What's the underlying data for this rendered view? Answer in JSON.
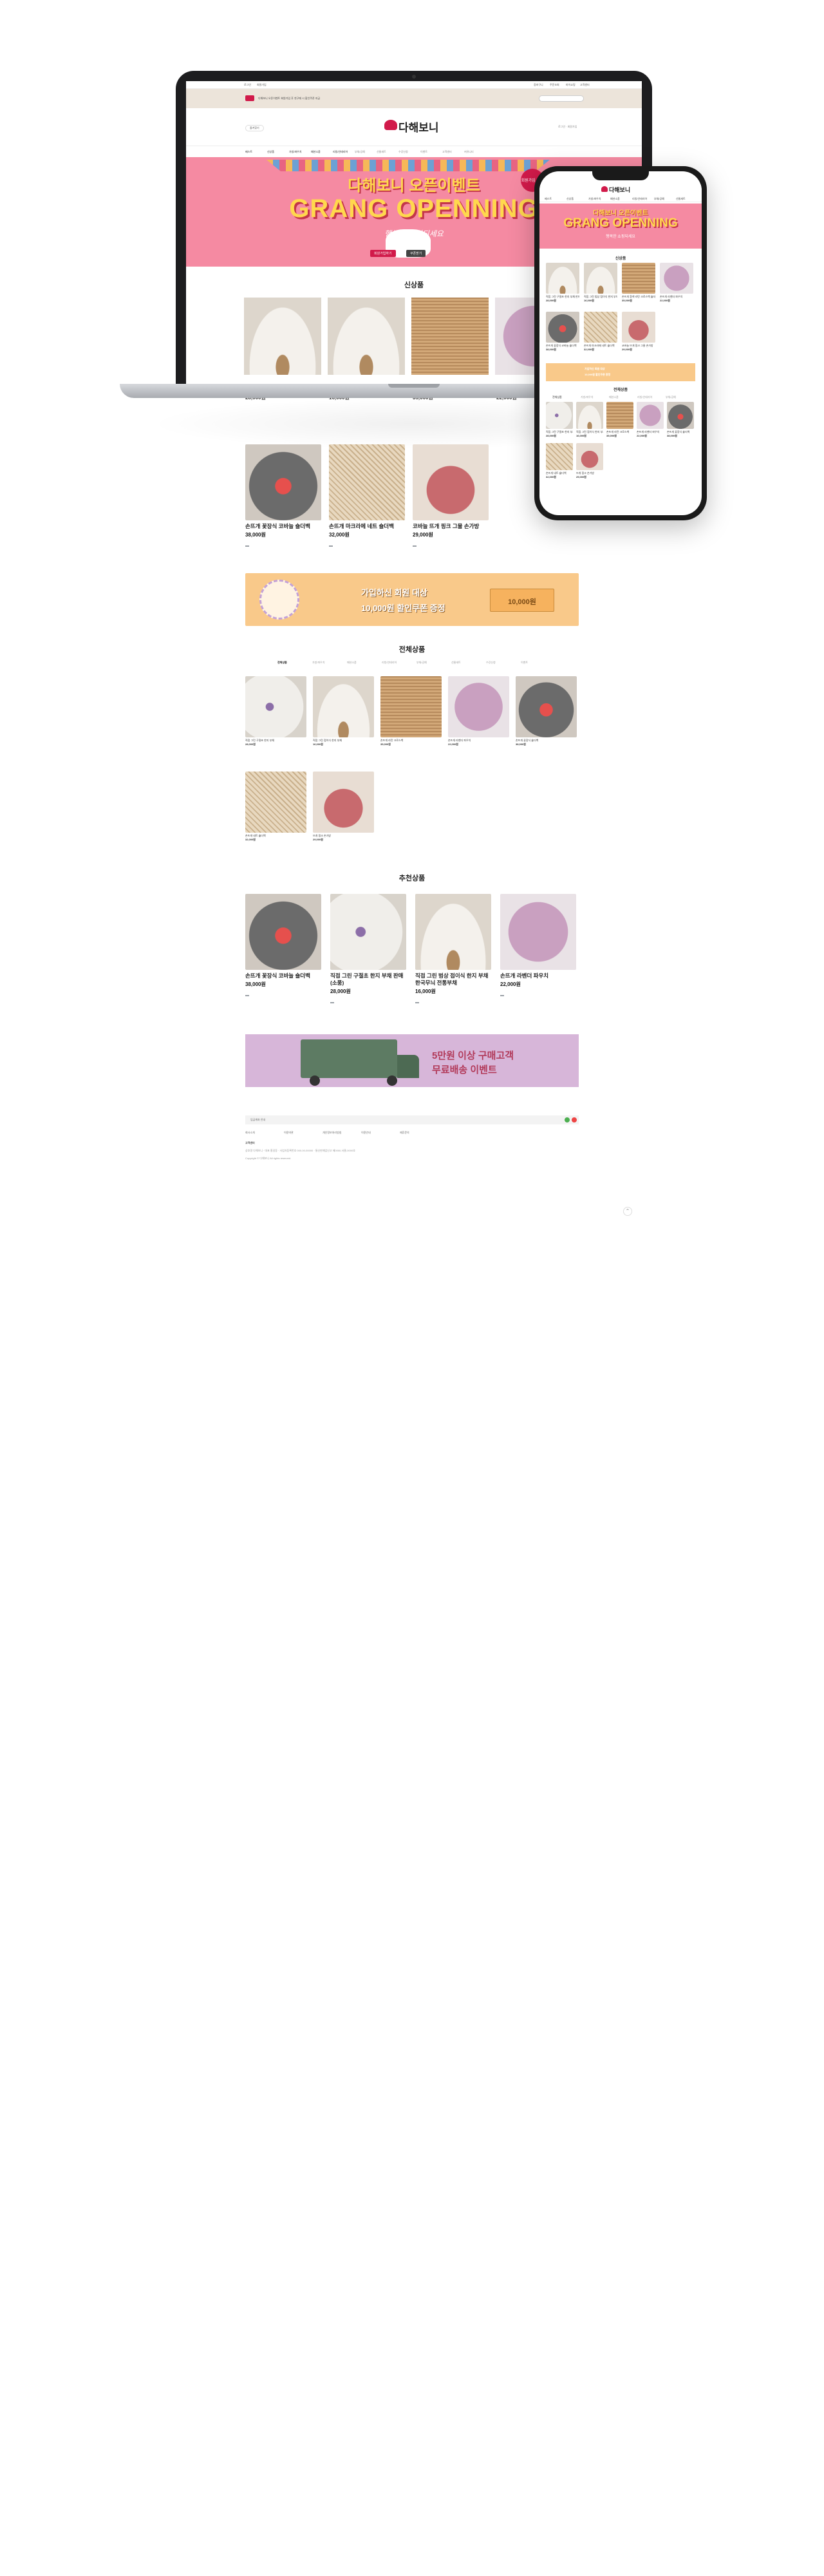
{
  "brand": {
    "logo_text": "다해보니",
    "accent": "#d11a4a",
    "banner_pink": "#f58aa2",
    "tan_bar": "#ece4da"
  },
  "top_bar": {
    "left_links": [
      "로그인",
      "회원가입"
    ],
    "right_links": [
      "장바구니",
      "주문조회",
      "마이쇼핑",
      "고객센터"
    ]
  },
  "notice_bar": {
    "text": "다해보니 오픈이벤트 회원가입 후 첫구매 시 할인쿠폰 지급"
  },
  "header": {
    "search_placeholder": "검색어를 입력하세요",
    "left_text": "즐겨찾기",
    "right_text": "로그인 · 회원가입"
  },
  "nav": {
    "items": [
      "베스트",
      "신상품",
      "가방/파우치",
      "패션소품",
      "리빙/인테리어",
      "부채/공예",
      "선물세트",
      "수강신청",
      "이벤트",
      "고객센터",
      "커뮤니티"
    ]
  },
  "hero": {
    "title_kr": "다해보니 오픈이벤트",
    "title_en": "GRANG OPENNING",
    "subtitle": "행복한 쇼핑되세요",
    "badge": "회원가입 즉시",
    "chip1": "회원가입하기",
    "chip2": "쿠폰받기"
  },
  "sections": {
    "new": "신상품",
    "all": "전체상품",
    "recommend": "추천상품"
  },
  "new_products": [
    {
      "name": "직접 그린 구절초 한지 부채 판매(소품)",
      "price": "28,000원",
      "img": "fan"
    },
    {
      "name": "직접 그린 범상 접이식 한지 부채 한국무늬 전통부채",
      "price": "16,000원",
      "img": "fan"
    },
    {
      "name": "손뜨개 흰색 라탄 크로스백 숄더백",
      "price": "35,000원",
      "img": "crochet"
    },
    {
      "name": "손뜨개 라벤더 파우치",
      "price": "22,000원",
      "img": "purple"
    },
    {
      "name": "손뜨개 꽃장식 코바늘 숄더백",
      "price": "38,000원",
      "img": "bag1"
    },
    {
      "name": "손뜨개 마크라메 네트 숄더백",
      "price": "32,000원",
      "img": "bag2"
    },
    {
      "name": "코바늘 뜨개 핑크 그물 손가방",
      "price": "29,000원",
      "img": "bag3"
    }
  ],
  "promo_thanks": {
    "text_line1": "가입하신 회원 대상",
    "text_line2": "10,000원 할인쿠폰 증정",
    "coupon": "10,000원"
  },
  "tabs": [
    "전체상품",
    "가방/파우치",
    "패션소품",
    "리빙/인테리어",
    "부채/공예",
    "선물세트",
    "수강신청",
    "이벤트"
  ],
  "all_products": [
    {
      "name": "직접 그린 구절초 한지 부채",
      "price": "28,000원",
      "img": "flower"
    },
    {
      "name": "직접 그린 접이식 한지 부채",
      "price": "16,000원",
      "img": "fan"
    },
    {
      "name": "손뜨개 라탄 크로스백",
      "price": "35,000원",
      "img": "crochet"
    },
    {
      "name": "손뜨개 라벤더 파우치",
      "price": "22,000원",
      "img": "purple"
    },
    {
      "name": "손뜨개 꽃장식 숄더백",
      "price": "38,000원",
      "img": "bag1"
    },
    {
      "name": "손뜨개 네트 숄더백",
      "price": "32,000원",
      "img": "bag2"
    },
    {
      "name": "뜨개 핑크 손가방",
      "price": "29,000원",
      "img": "bag3"
    }
  ],
  "recommend_products": [
    {
      "name": "손뜨개 꽃장식 코바늘 숄더백",
      "price": "38,000원",
      "img": "bag1"
    },
    {
      "name": "직접 그린 구절초 한지 부채 판매(소품)",
      "price": "28,000원",
      "img": "flower"
    },
    {
      "name": "직접 그린 범상 접이식 한지 부채 한국무늬 전통부채",
      "price": "16,000원",
      "img": "fan"
    },
    {
      "name": "손뜨개 라벤더 파우치",
      "price": "22,000원",
      "img": "purple"
    }
  ],
  "promo_delivery": {
    "title": "5만원 이상 구매고객",
    "subtitle": "무료배송 이벤트"
  },
  "footer": {
    "bank": "입금계좌 안내",
    "links": [
      "회사소개",
      "이용약관",
      "개인정보처리방침",
      "이용안내",
      "제휴문의"
    ],
    "cs_title": "고객센터",
    "info": "상호명 다해보니 · 대표 홍길동 · 사업자등록번호 000-00-00000 · 통신판매업신고 제0000-서울-0000호",
    "copyright": "Copyright © 다해보니 All rights reserved."
  }
}
